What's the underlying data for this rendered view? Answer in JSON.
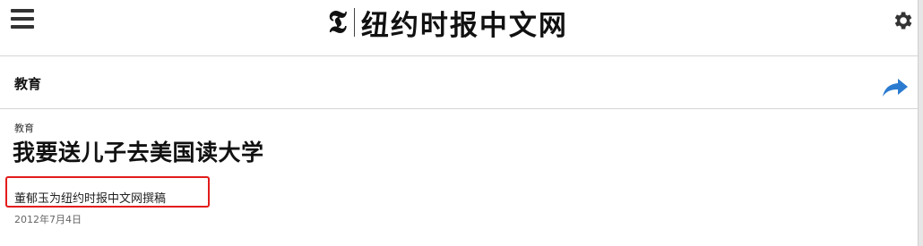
{
  "header": {
    "logo_glyph": "𝕿",
    "site_name": "纽约时报中文网",
    "menu_icon": "hamburger-menu-icon",
    "settings_icon": "gear-icon"
  },
  "section": {
    "title": "教育",
    "share_icon": "share-arrow-icon",
    "share_color": "#2a7bd0"
  },
  "article": {
    "kicker": "教育",
    "headline": "我要送儿子去美国读大学",
    "byline": "董郁玉为纽约时报中文网撰稿",
    "date": "2012年7月4日",
    "highlight_color": "#e31b1b"
  }
}
